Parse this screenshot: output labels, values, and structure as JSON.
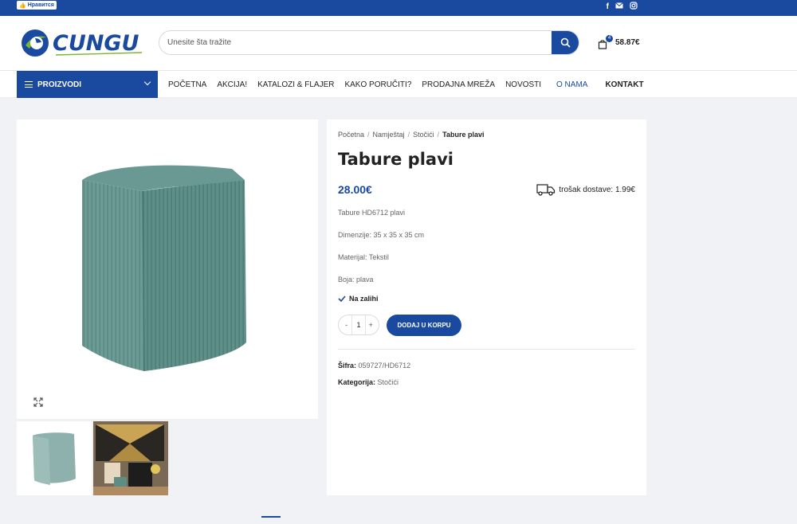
{
  "topbar": {
    "like_label": "Нравится",
    "icons": [
      "facebook-icon",
      "mail-icon",
      "instagram-icon"
    ]
  },
  "brand": {
    "name": "CUNGU",
    "colors": {
      "primary": "#1a4aa0",
      "accent_green": "#7ab72e"
    }
  },
  "search": {
    "placeholder": "Unesite šta tražite"
  },
  "cart": {
    "count": "4",
    "total": "58.87€"
  },
  "nav": {
    "categories_label": "PROIZVODI",
    "items": [
      "POČETNA",
      "AKCIJA!",
      "KATALOZI & FLAJER",
      "KAKO PORUČITI?",
      "PRODAJNA MREŽA",
      "NOVOSTI"
    ],
    "right_items": [
      "O NAMA",
      "KONTAKT"
    ]
  },
  "breadcrumb": [
    "Početna",
    "Namještaj",
    "Stočići",
    "Tabure plavi"
  ],
  "product": {
    "title": "Tabure plavi",
    "price": "28.00€",
    "shipping": "trošak dostave: 1.99€",
    "description": [
      "Tabure HD6712 plavi",
      "Dimenzije: 35 x 35 x 35 cm",
      "Materijal: Tekstil",
      "Boja: plava"
    ],
    "stock": "Na zalihi",
    "quantity": "1",
    "add_to_cart": "DODAJ U KORPU",
    "sku_label": "Šifra:",
    "sku": "059727/HD6712",
    "category_label": "Kategorija:",
    "category": "Stočići",
    "color": "#5e8d86"
  }
}
